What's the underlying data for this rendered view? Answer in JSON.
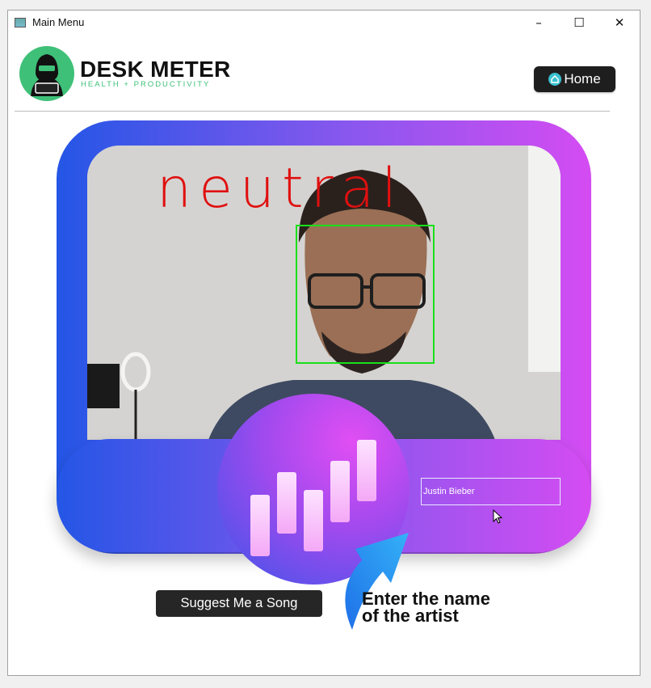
{
  "window": {
    "title": "Main Menu",
    "controls": {
      "minimize": "–",
      "maximize": "☐",
      "close": "✕"
    }
  },
  "header": {
    "brand": "DESK METER",
    "tagline": "HEALTH + PRODUCTIVITY",
    "home_label": "Home"
  },
  "camera": {
    "emotion": "neutral"
  },
  "artist": {
    "value": "Justin Bieber"
  },
  "actions": {
    "suggest_label": "Suggest Me a Song",
    "hint_line1": "Enter the name",
    "hint_line2": "of the artist"
  },
  "colors": {
    "accent_blue": "#2456e6",
    "accent_pink": "#d44cf2",
    "detect_box": "#19e019",
    "emotion_text": "#e01010",
    "brand_green": "#3fc078"
  },
  "icons": [
    "app-icon",
    "logo-hacker-icon",
    "home-icon",
    "music-bars-icon",
    "curved-arrow-icon",
    "mouse-cursor-icon"
  ]
}
